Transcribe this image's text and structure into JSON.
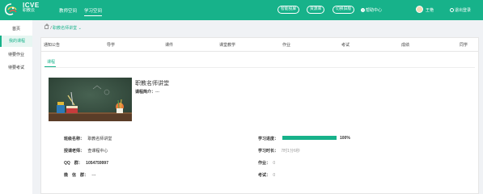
{
  "header": {
    "brand_title": "ICVE",
    "brand_subtitle": "职教云",
    "nav": [
      "教师空间",
      "学习空间"
    ],
    "buttons": [
      "智能投屏",
      "资源库",
      "切换旧版"
    ],
    "help": "帮助中心",
    "user": "王艳",
    "logout": "退出登录"
  },
  "sidebar": {
    "items": [
      "首页",
      "我的课程",
      "待要作业",
      "待要考试"
    ]
  },
  "breadcrumb": {
    "current": "职教名师讲堂"
  },
  "tabs": [
    "通知公告",
    "导学",
    "课件",
    "课堂教学",
    "作业",
    "考试",
    "成绩",
    "同学"
  ],
  "subtab": "课程",
  "course": {
    "title": "职教名师讲堂",
    "intro_label": "课程简介：",
    "intro_value": "---"
  },
  "details": {
    "class_name_label": "班级名称：",
    "class_name": "职教名师讲堂",
    "teacher_label": "授课老师：",
    "teacher": "查课程中心",
    "qq_label": "QQ　群：",
    "qq": "1054759997",
    "wechat_label": "微　信　群：",
    "wechat": "---",
    "progress_label": "学习进度：",
    "progress_value": "100%",
    "progress_fraction": 1.0,
    "time_label": "学习时长：",
    "time_value": "7时1分6秒",
    "homework_label": "作业：",
    "homework_value": "0",
    "exam_label": "考试：",
    "exam_value": "0"
  },
  "colors": {
    "accent": "#17b28a"
  }
}
